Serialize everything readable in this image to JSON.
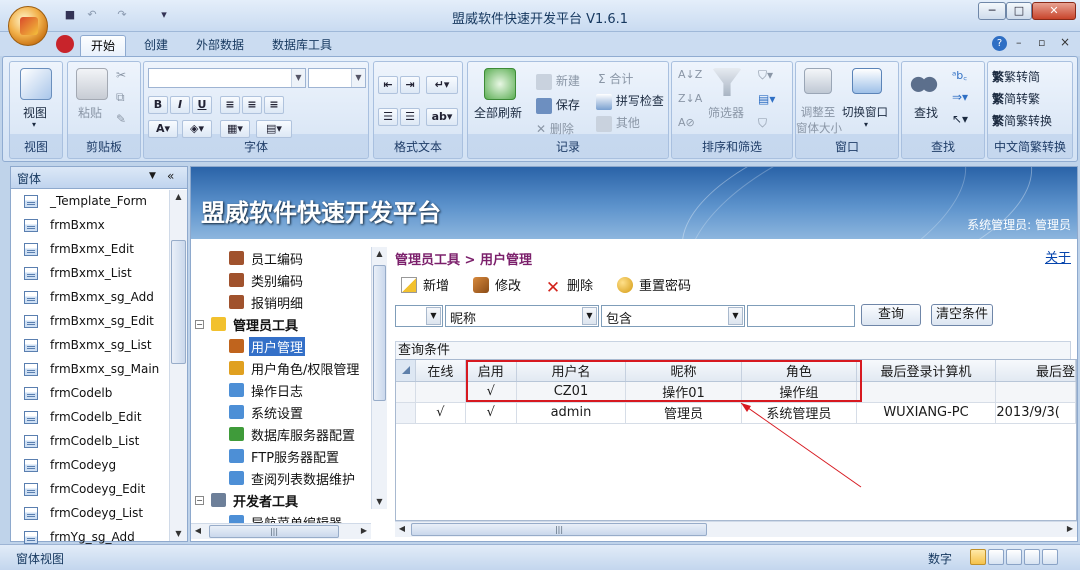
{
  "window": {
    "title": "盟威软件快速开发平台 V1.6.1",
    "controls": [
      "─",
      "□",
      "✕"
    ],
    "help": "?"
  },
  "quick_access": {
    "items": [
      "save-icon",
      "undo-icon",
      "redo-icon",
      "customize-icon"
    ]
  },
  "ribbon_tabs": [
    "开始",
    "创建",
    "外部数据",
    "数据库工具"
  ],
  "ribbon": {
    "groups": {
      "view": "视图",
      "clipboard": "剪贴板",
      "font": "字体",
      "rich_text": "格式文本",
      "records": "记录",
      "sort_filter": "排序和筛选",
      "window": "窗口",
      "find": "查找",
      "convert": "中文简繁转换"
    },
    "view_btn": "视图",
    "paste_btn": "粘贴",
    "refresh_btn": "全部刷新",
    "new": "新建",
    "save": "保存",
    "delete": "删除",
    "sum": "合计",
    "spell": "拼写检查",
    "more": "其他",
    "filter_btn": "筛选器",
    "fit_btn": "调整至\n窗体大小",
    "switch_btn": "切换窗口",
    "find_btn": "查找",
    "trad_to_simp": "繁转简",
    "simp_to_trad": "简转繁",
    "simp_trad_convert": "简繁转换"
  },
  "nav": {
    "header": "窗体",
    "items": [
      "_Template_Form",
      "frmBxmx",
      "frmBxmx_Edit",
      "frmBxmx_List",
      "frmBxmx_sg_Add",
      "frmBxmx_sg_Edit",
      "frmBxmx_sg_List",
      "frmBxmx_sg_Main",
      "frmCodelb",
      "frmCodelb_Edit",
      "frmCodelb_List",
      "frmCodeyg",
      "frmCodeyg_Edit",
      "frmCodeyg_List",
      "frmYg_sg_Add"
    ]
  },
  "banner": {
    "title": "盟威软件快速开发平台",
    "user": "系统管理员: 管理员"
  },
  "tree": {
    "nodes": [
      {
        "label": "员工编码",
        "level": 2,
        "icon": "#a0522d"
      },
      {
        "label": "类别编码",
        "level": 2,
        "icon": "#a0522d"
      },
      {
        "label": "报销明细",
        "level": 2,
        "icon": "#a0522d"
      },
      {
        "label": "管理员工具",
        "level": 1,
        "icon": "#f2c12e"
      },
      {
        "label": "用户管理",
        "level": 2,
        "icon": "#c0641d"
      },
      {
        "label": "用户角色/权限管理",
        "level": 2,
        "icon": "#e0a020"
      },
      {
        "label": "操作日志",
        "level": 2,
        "icon": "#4d8fd6"
      },
      {
        "label": "系统设置",
        "level": 2,
        "icon": "#4d8fd6"
      },
      {
        "label": "数据库服务器配置",
        "level": 2,
        "icon": "#3f9b3a"
      },
      {
        "label": "FTP服务器配置",
        "level": 2,
        "icon": "#4d8fd6"
      },
      {
        "label": "查阅列表数据维护",
        "level": 2,
        "icon": "#4d8fd6"
      },
      {
        "label": "开发者工具",
        "level": 1,
        "icon": "#6d7f99"
      },
      {
        "label": "导航菜单编辑器",
        "level": 2,
        "icon": "#4d8fd6"
      }
    ]
  },
  "panel": {
    "breadcrumb": "管理员工具 > 用户管理",
    "close_link": "关于",
    "toolbar": {
      "add": "新增",
      "edit": "修改",
      "delete": "删除",
      "reset_pwd": "重置密码"
    },
    "filter": {
      "logic": "",
      "field": "昵称",
      "op": "包含",
      "value": "",
      "query_btn": "查询",
      "clear_btn": "清空条件"
    },
    "condition_label": "查询条件"
  },
  "table": {
    "columns": [
      "在线",
      "启用",
      "用户名",
      "昵称",
      "角色",
      "最后登录计算机",
      "最后登"
    ],
    "rows": [
      [
        "",
        "√",
        "CZ01",
        "操作01",
        "操作组",
        "",
        ""
      ],
      [
        "√",
        "√",
        "admin",
        "管理员",
        "系统管理员",
        "WUXIANG-PC",
        "2013/9/3("
      ]
    ]
  },
  "status": {
    "left": "窗体视图",
    "right": "数字"
  },
  "colors": {
    "accent": "#3470c8",
    "highlight_box": "#d71920",
    "annotation_arrow": "#d71920"
  }
}
